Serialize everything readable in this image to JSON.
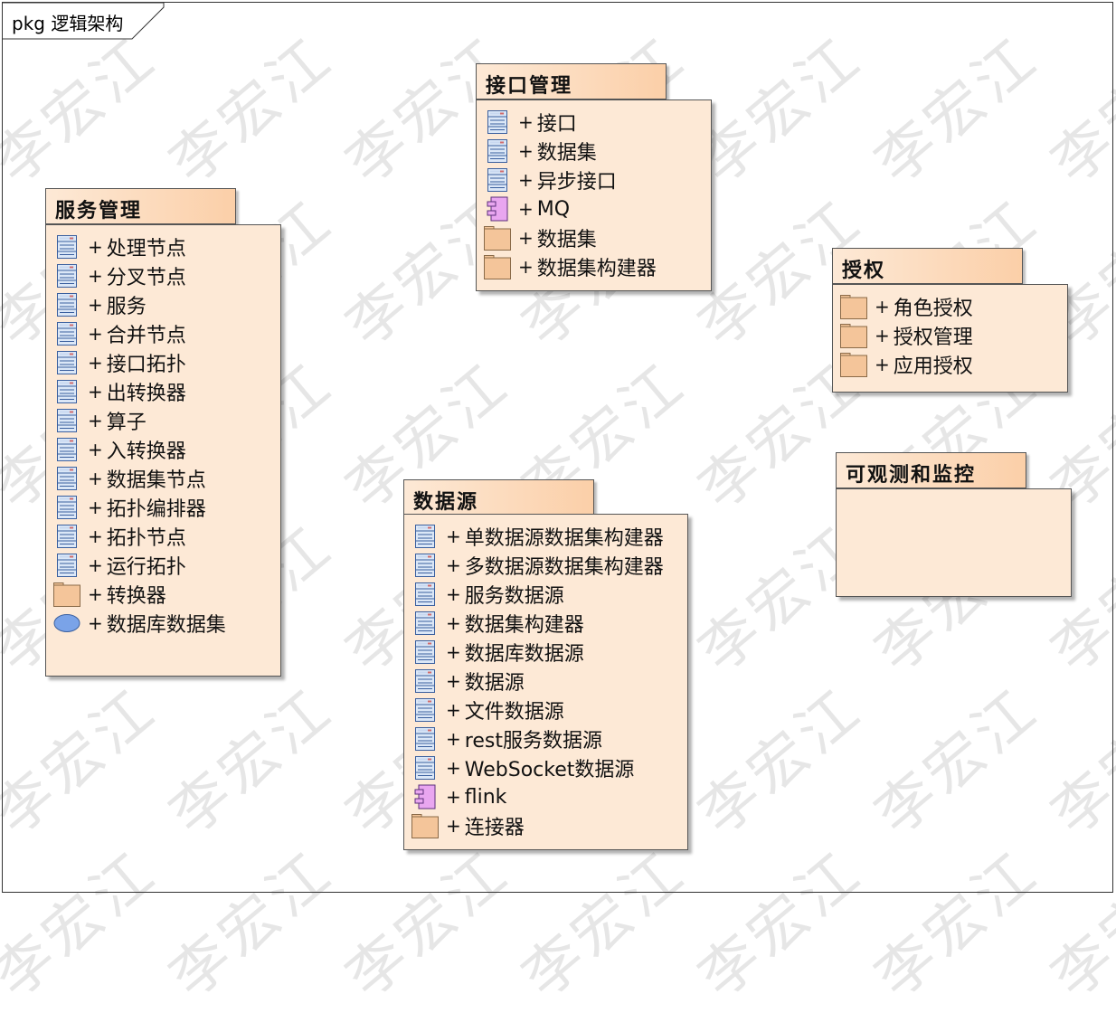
{
  "frame": {
    "label": "pkg 逻辑架构"
  },
  "watermark": {
    "text": "李宏江"
  },
  "packages": [
    {
      "id": "service",
      "title": "服务管理",
      "items": [
        {
          "label": "处理节点",
          "icon": "class-icon"
        },
        {
          "label": "分叉节点",
          "icon": "class-icon"
        },
        {
          "label": "服务",
          "icon": "class-icon"
        },
        {
          "label": "合并节点",
          "icon": "class-icon"
        },
        {
          "label": "接口拓扑",
          "icon": "class-icon"
        },
        {
          "label": "出转换器",
          "icon": "class-icon"
        },
        {
          "label": "算子",
          "icon": "class-icon"
        },
        {
          "label": "入转换器",
          "icon": "class-icon"
        },
        {
          "label": "数据集节点",
          "icon": "class-icon"
        },
        {
          "label": "拓扑编排器",
          "icon": "class-icon"
        },
        {
          "label": "拓扑节点",
          "icon": "class-icon"
        },
        {
          "label": "运行拓扑",
          "icon": "class-icon"
        },
        {
          "label": "转换器",
          "icon": "package-icon"
        },
        {
          "label": "数据库数据集",
          "icon": "usecase-icon"
        }
      ]
    },
    {
      "id": "interface",
      "title": "接口管理",
      "items": [
        {
          "label": "接口",
          "icon": "class-icon"
        },
        {
          "label": "数据集",
          "icon": "class-icon"
        },
        {
          "label": "异步接口",
          "icon": "class-icon"
        },
        {
          "label": "MQ",
          "icon": "component-icon"
        },
        {
          "label": "数据集",
          "icon": "package-icon"
        },
        {
          "label": "数据集构建器",
          "icon": "package-icon"
        }
      ]
    },
    {
      "id": "datasource",
      "title": "数据源",
      "items": [
        {
          "label": "单数据源数据集构建器",
          "icon": "class-icon"
        },
        {
          "label": "多数据源数据集构建器",
          "icon": "class-icon"
        },
        {
          "label": "服务数据源",
          "icon": "class-icon"
        },
        {
          "label": "数据集构建器",
          "icon": "class-icon"
        },
        {
          "label": "数据库数据源",
          "icon": "class-icon"
        },
        {
          "label": "数据源",
          "icon": "class-icon"
        },
        {
          "label": "文件数据源",
          "icon": "class-icon"
        },
        {
          "label": "rest服务数据源",
          "icon": "class-icon"
        },
        {
          "label": "WebSocket数据源",
          "icon": "class-icon"
        },
        {
          "label": "flink",
          "icon": "component-icon"
        },
        {
          "label": "连接器",
          "icon": "package-icon"
        }
      ]
    },
    {
      "id": "auth",
      "title": "授权",
      "items": [
        {
          "label": "角色授权",
          "icon": "package-icon"
        },
        {
          "label": "授权管理",
          "icon": "package-icon"
        },
        {
          "label": "应用授权",
          "icon": "package-icon"
        }
      ]
    },
    {
      "id": "observe",
      "title": "可观测和监控",
      "items": []
    }
  ]
}
